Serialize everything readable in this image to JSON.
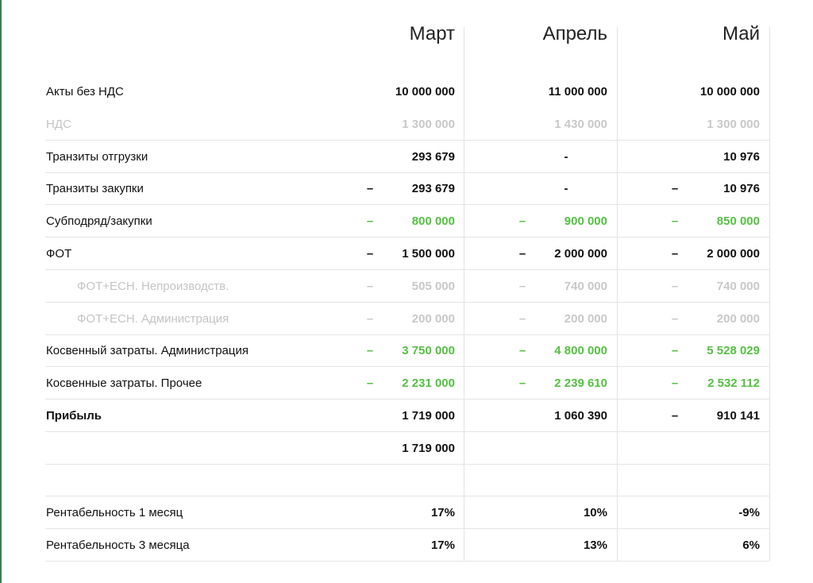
{
  "months": [
    "Март",
    "Апрель",
    "Май"
  ],
  "rows": [
    {
      "label": "Акты без НДС",
      "style": "normal",
      "indent": false,
      "cells": [
        {
          "minus": "",
          "value": "10 000 000"
        },
        {
          "minus": "",
          "value": "11 000 000"
        },
        {
          "minus": "",
          "value": "10 000 000"
        }
      ]
    },
    {
      "label": "НДС",
      "style": "muted",
      "indent": false,
      "cells": [
        {
          "minus": "",
          "value": "1 300 000"
        },
        {
          "minus": "",
          "value": "1 430 000"
        },
        {
          "minus": "",
          "value": "1 300 000"
        }
      ]
    },
    {
      "label": "Транзиты отгрузки",
      "style": "normal",
      "indent": false,
      "cells": [
        {
          "minus": "",
          "value": "293 679"
        },
        {
          "minus": "",
          "value": "-"
        },
        {
          "minus": "",
          "value": "10 976"
        }
      ]
    },
    {
      "label": "Транзиты закупки",
      "style": "normal",
      "indent": false,
      "cells": [
        {
          "minus": "–",
          "value": "293 679"
        },
        {
          "minus": "",
          "value": "-"
        },
        {
          "minus": "–",
          "value": "10 976"
        }
      ]
    },
    {
      "label": "Субподряд/закупки",
      "style": "green",
      "indent": false,
      "cells": [
        {
          "minus": "–",
          "value": "800 000"
        },
        {
          "minus": "–",
          "value": "900 000"
        },
        {
          "minus": "–",
          "value": "850 000"
        }
      ]
    },
    {
      "label": "ФОТ",
      "style": "normal",
      "indent": false,
      "cells": [
        {
          "minus": "–",
          "value": "1 500 000"
        },
        {
          "minus": "–",
          "value": "2 000 000"
        },
        {
          "minus": "–",
          "value": "2 000 000"
        }
      ]
    },
    {
      "label": "ФОТ+ЕСН. Непроизводств.",
      "style": "muted",
      "indent": true,
      "cells": [
        {
          "minus": "–",
          "value": "505 000"
        },
        {
          "minus": "–",
          "value": "740 000"
        },
        {
          "minus": "–",
          "value": "740 000"
        }
      ]
    },
    {
      "label": "ФОТ+ЕСН. Администрация",
      "style": "muted",
      "indent": true,
      "cells": [
        {
          "minus": "–",
          "value": "200 000"
        },
        {
          "minus": "–",
          "value": "200 000"
        },
        {
          "minus": "–",
          "value": "200 000"
        }
      ]
    },
    {
      "label": "Косвенный затраты. Администрация",
      "style": "green",
      "indent": false,
      "cells": [
        {
          "minus": "–",
          "value": "3 750 000"
        },
        {
          "minus": "–",
          "value": "4 800 000"
        },
        {
          "minus": "–",
          "value": "5 528 029"
        }
      ]
    },
    {
      "label": "Косвенные затраты. Прочее",
      "style": "green",
      "indent": false,
      "cells": [
        {
          "minus": "–",
          "value": "2 231 000"
        },
        {
          "minus": "–",
          "value": "2 239 610"
        },
        {
          "minus": "–",
          "value": "2 532 112"
        }
      ]
    },
    {
      "label": "Прибыль",
      "style": "bold",
      "indent": false,
      "cells": [
        {
          "minus": "",
          "value": "1 719 000"
        },
        {
          "minus": "",
          "value": "1 060 390"
        },
        {
          "minus": "–",
          "value": "910 141"
        }
      ]
    }
  ],
  "cumulative": {
    "values": [
      "1 719 000",
      "",
      ""
    ]
  },
  "profitability": [
    {
      "label": "Рентабельность 1 месяц",
      "values": [
        "17%",
        "10%",
        "-9%"
      ]
    },
    {
      "label": "Рентабельность 3 месяца",
      "values": [
        "17%",
        "13%",
        "6%"
      ]
    }
  ],
  "colors": {
    "green": "#55c043",
    "muted": "#c8c8c8",
    "line": "#e4e4e4",
    "edge": "#3a7d55"
  }
}
